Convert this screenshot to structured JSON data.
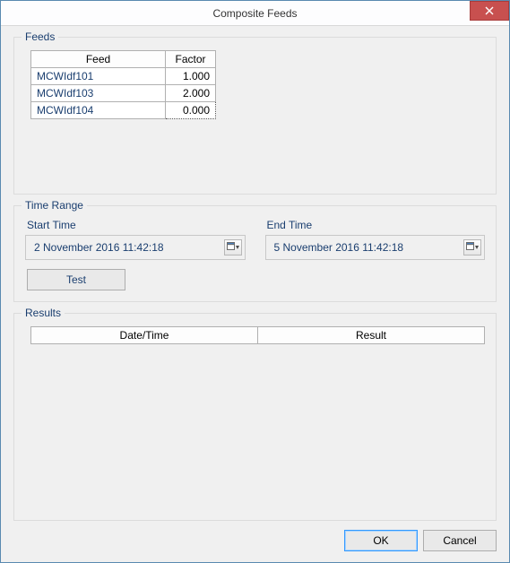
{
  "window": {
    "title": "Composite Feeds"
  },
  "feeds": {
    "legend": "Feeds",
    "columns": {
      "feed": "Feed",
      "factor": "Factor"
    },
    "rows": [
      {
        "feed": "MCWIdf101",
        "factor": "1.000"
      },
      {
        "feed": "MCWIdf103",
        "factor": "2.000"
      },
      {
        "feed": "MCWIdf104",
        "factor": "0.000"
      }
    ],
    "selected_row_index": 2
  },
  "time_range": {
    "legend": "Time Range",
    "start": {
      "label": "Start Time",
      "value": "2 November 2016  11:42:18"
    },
    "end": {
      "label": "End Time",
      "value": "5 November 2016  11:42:18"
    },
    "test_label": "Test"
  },
  "results": {
    "legend": "Results",
    "columns": {
      "datetime": "Date/Time",
      "result": "Result"
    },
    "rows": []
  },
  "buttons": {
    "ok": "OK",
    "cancel": "Cancel"
  }
}
